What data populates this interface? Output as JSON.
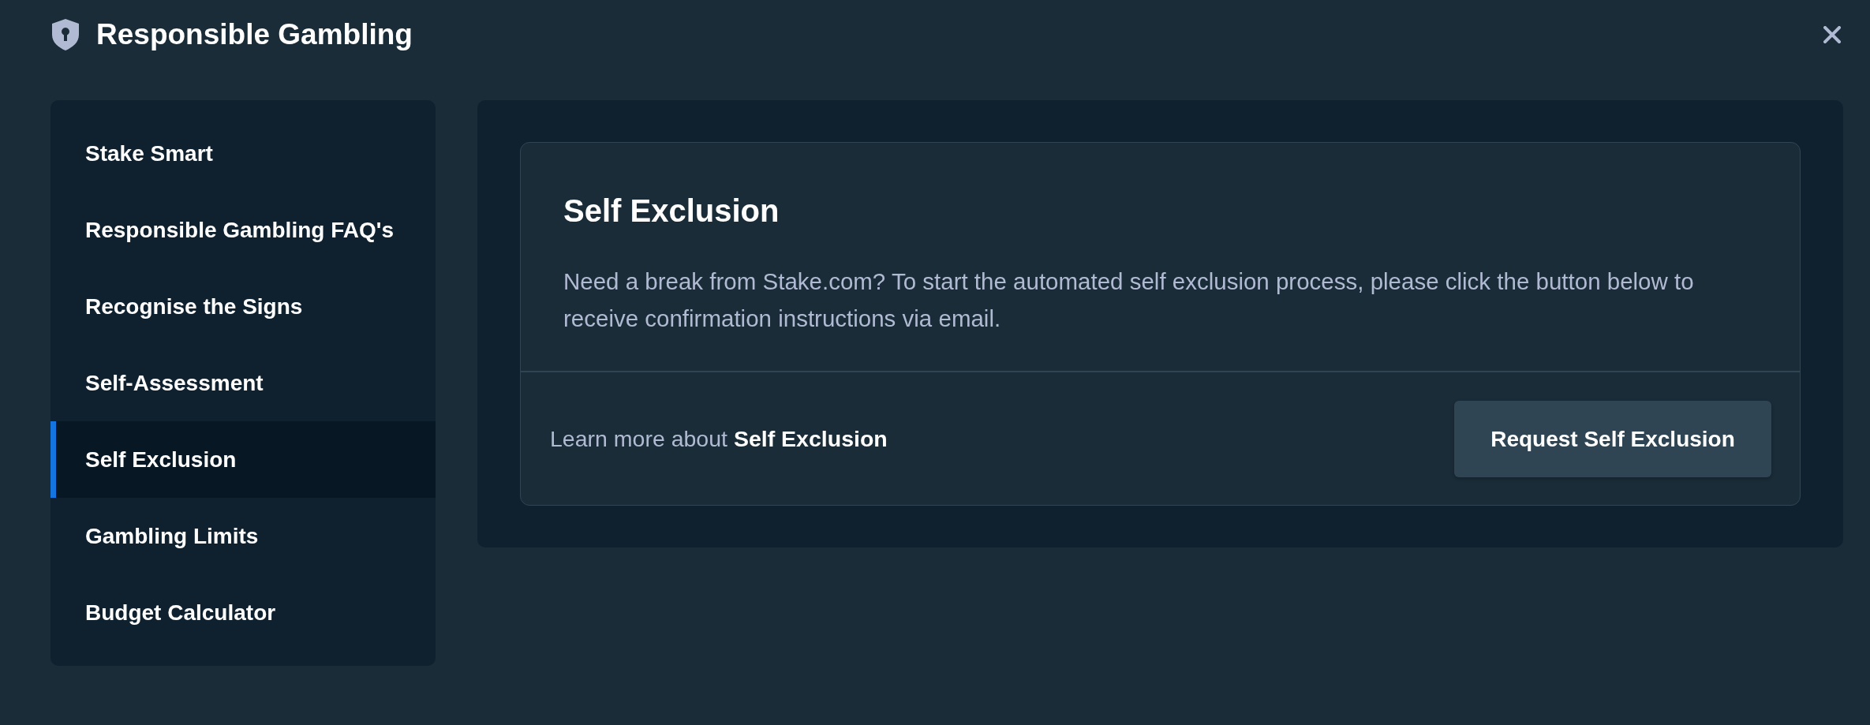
{
  "header": {
    "title": "Responsible Gambling"
  },
  "sidebar": {
    "items": [
      {
        "label": "Stake Smart",
        "selected": false
      },
      {
        "label": "Responsible Gambling FAQ's",
        "selected": false
      },
      {
        "label": "Recognise the Signs",
        "selected": false
      },
      {
        "label": "Self-Assessment",
        "selected": false
      },
      {
        "label": "Self Exclusion",
        "selected": true
      },
      {
        "label": "Gambling Limits",
        "selected": false
      },
      {
        "label": "Budget Calculator",
        "selected": false
      }
    ]
  },
  "card": {
    "title": "Self Exclusion",
    "description": "Need a break from Stake.com? To start the automated self exclusion process, please click the button below to receive confirmation instructions via email.",
    "learn_more": "Learn more about **Self Exclusion**",
    "button": "Request Self Exclusion"
  }
}
